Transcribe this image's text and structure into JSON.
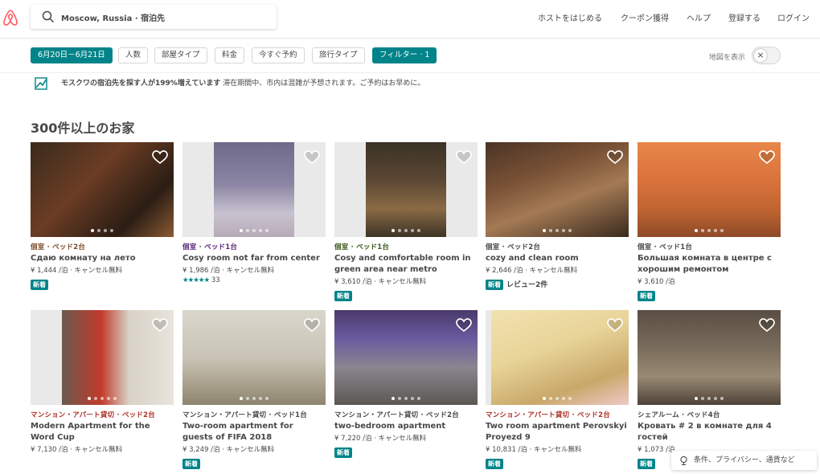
{
  "colors": {
    "brand": "#FF5A5F",
    "accent": "#008489",
    "text": "#484848"
  },
  "header": {
    "logo_icon": "airbnb-logo",
    "search_icon": "search-icon",
    "search_value": "Moscow, Russia · 宿泊先",
    "nav": [
      "ホストをはじめる",
      "クーポン獲得",
      "ヘルプ",
      "登録する",
      "ログイン"
    ]
  },
  "filters": {
    "chips": [
      "6月20日－6月21日",
      "人数",
      "部屋タイプ",
      "料金",
      "今すぐ予約",
      "旅行タイプ",
      "フィルター · 1"
    ],
    "map_label": "地図を表示",
    "map_toggle": "×"
  },
  "banner": {
    "bold": "モスクワの宿泊先を探す人が199%増えています",
    "text": "滞在期間中、市内は混雑が予想されます。ご予約はお早めに。"
  },
  "section_title": "300件以上のお家",
  "listings": [
    {
      "kind": "個室 · ベッド2台",
      "kind_color": "#7E4A2A",
      "title": "Сдаю комнату на лето",
      "price": "¥ 1,444 /泊 · キャンセル無料",
      "badge": "新着",
      "review": "",
      "stars": "",
      "rating_count": ""
    },
    {
      "kind": "個室 · ベッド1台",
      "kind_color": "#5A2A7E",
      "title": "Cosy room not far from center",
      "price": "¥ 1,986 /泊 · キャンセル無料",
      "badge": "",
      "review": "",
      "stars": "★★★★★",
      "rating_count": "33"
    },
    {
      "kind": "個室 · ベッド1台",
      "kind_color": "#3C5A1E",
      "title": "Cosy and comfortable room in green area near metro",
      "price": "¥ 3,610 /泊 · キャンセル無料",
      "badge": "新着",
      "review": "",
      "stars": "",
      "rating_count": ""
    },
    {
      "kind": "個室 · ベッド2台",
      "kind_color": "#484848",
      "title": "cozy and clean room",
      "price": "¥ 2,646 /泊 · キャンセル無料",
      "badge": "新着",
      "review": "レビュー2件",
      "stars": "",
      "rating_count": ""
    },
    {
      "kind": "個室 · ベッド1台",
      "kind_color": "#484848",
      "title": "Большая комната в центре с хорошим ремонтом",
      "price": "¥ 3,610 /泊",
      "badge": "新着",
      "review": "",
      "stars": "",
      "rating_count": ""
    },
    {
      "kind": "マンション・アパート貸切 · ベッド2台",
      "kind_color": "#B0312A",
      "title": "Modern Apartment for the Word Cup",
      "price": "¥ 7,130 /泊 · キャンセル無料",
      "badge": "",
      "review": "",
      "stars": "",
      "rating_count": ""
    },
    {
      "kind": "マンション・アパート貸切 · ベッド1台",
      "kind_color": "#484848",
      "title": "Two-room apartment for guests of FIFA 2018",
      "price": "¥ 3,249 /泊 · キャンセル無料",
      "badge": "新着",
      "review": "",
      "stars": "",
      "rating_count": ""
    },
    {
      "kind": "マンション・アパート貸切 · ベッド2台",
      "kind_color": "#484848",
      "title": "two-bedroom apartment",
      "price": "¥ 7,220 /泊 · キャンセル無料",
      "badge": "新着",
      "review": "",
      "stars": "",
      "rating_count": ""
    },
    {
      "kind": "マンション・アパート貸切 · ベッド2台",
      "kind_color": "#B0312A",
      "title": "Two room apartment Perovskyi Proyezd 9",
      "price": "¥ 10,831 /泊 · キャンセル無料",
      "badge": "新着",
      "review": "",
      "stars": "",
      "rating_count": ""
    },
    {
      "kind": "シェアルーム · ベッド4台",
      "kind_color": "#484848",
      "title": "Кровать # 2 в комнате для 4 гостей",
      "price": "¥ 1,073 /泊",
      "badge": "新着",
      "review": "",
      "stars": "",
      "rating_count": ""
    }
  ],
  "footer": {
    "icon": "globe-icon",
    "text": "条件、プライバシー、通貨など"
  }
}
